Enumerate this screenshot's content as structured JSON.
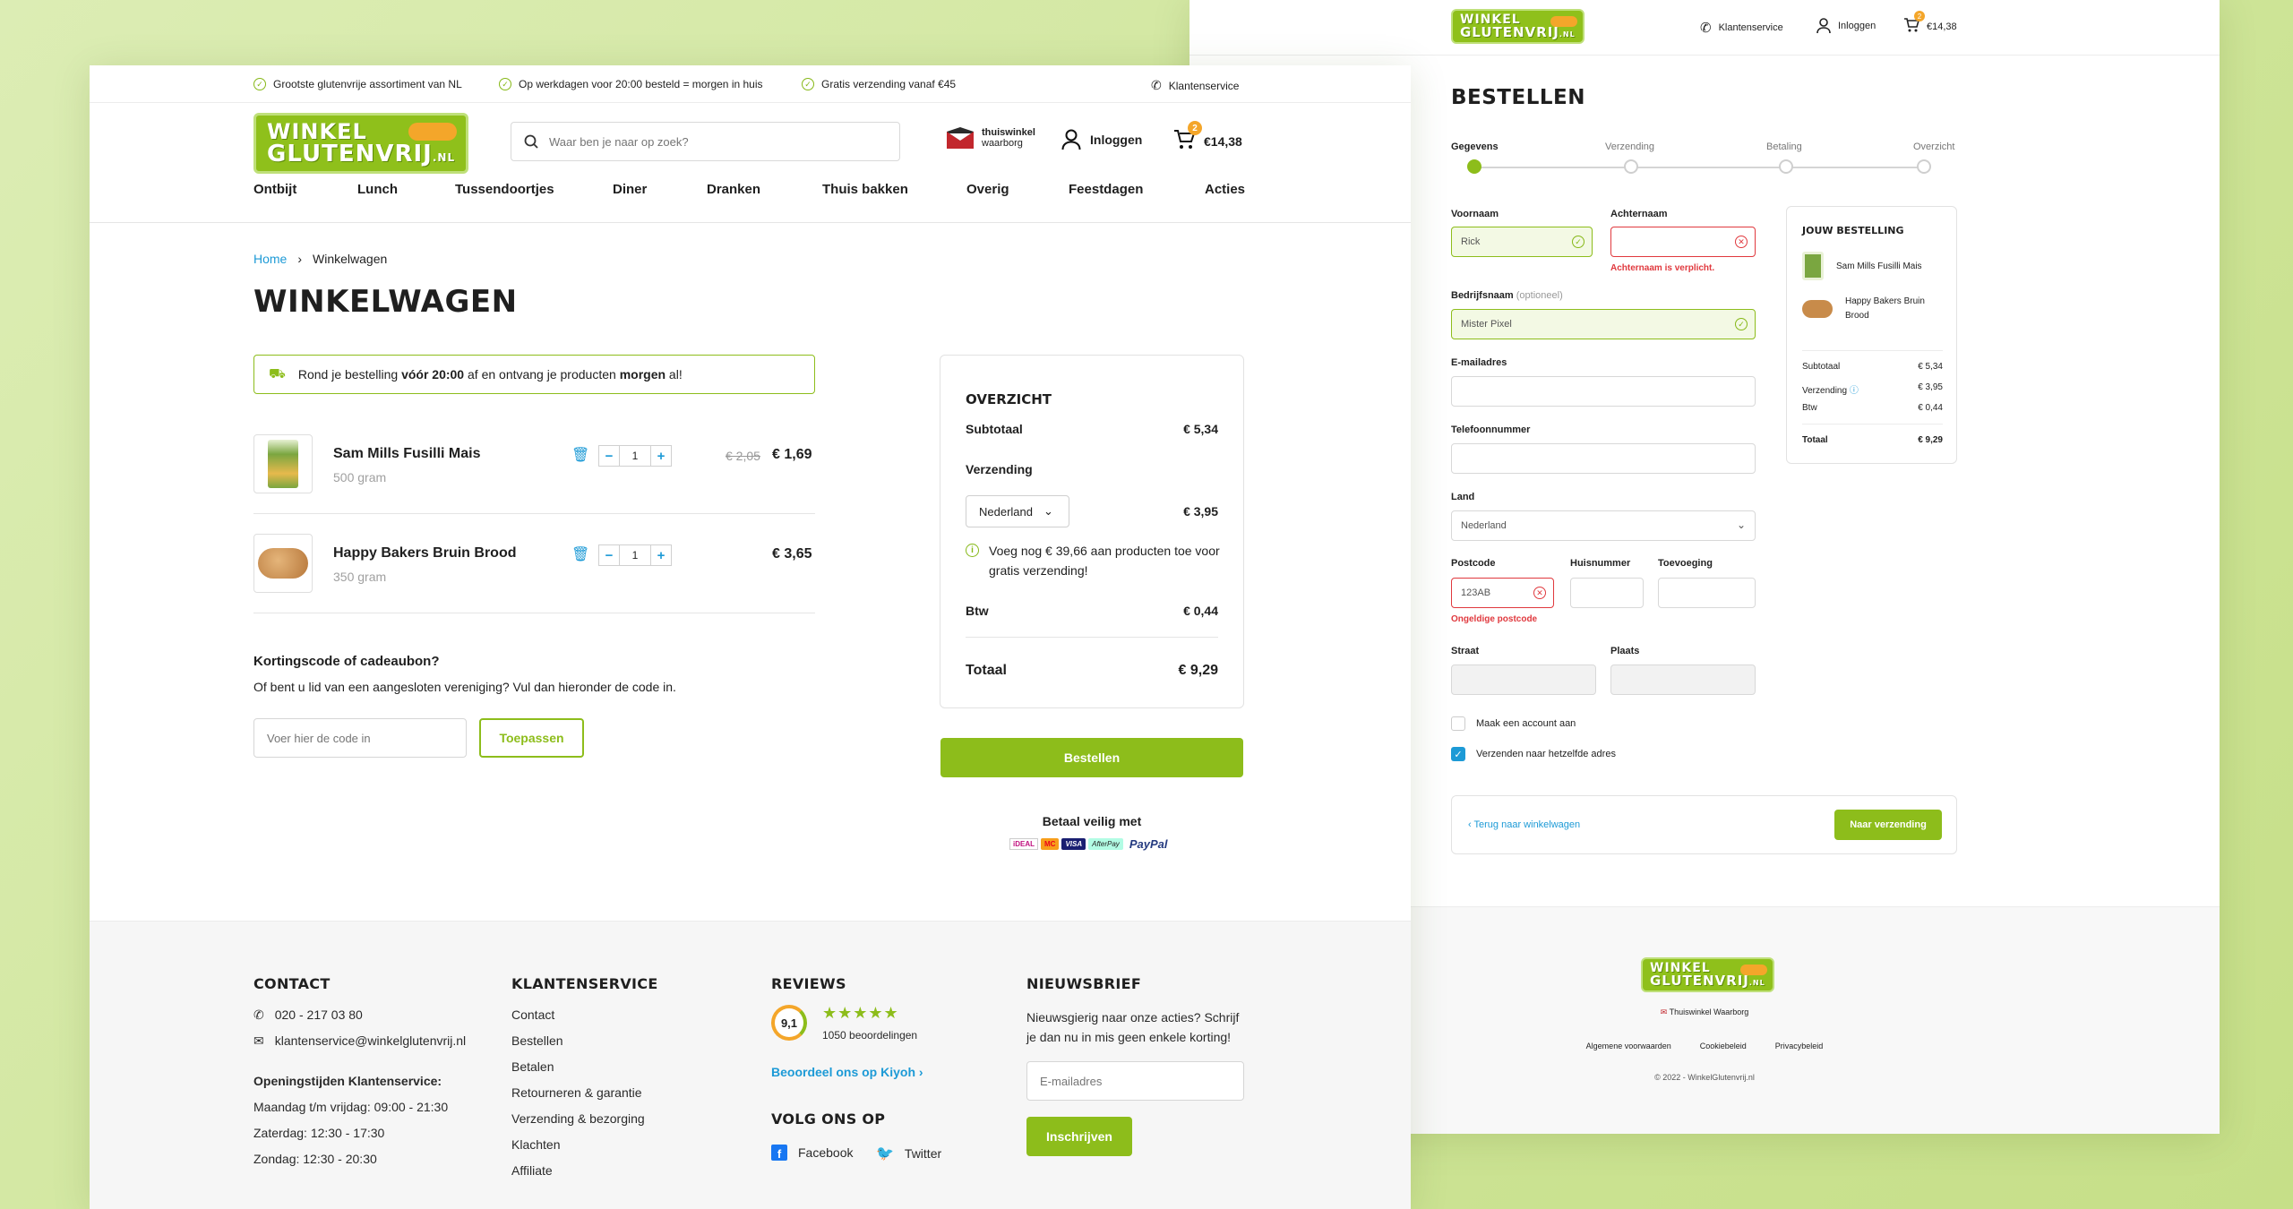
{
  "cart_page": {
    "usps": [
      "Grootste glutenvrije assortiment van NL",
      "Op werkdagen voor 20:00 besteld = morgen in huis",
      "Gratis verzending vanaf €45"
    ],
    "customer_service": "Klantenservice",
    "logo": {
      "line1": "WINKEL",
      "line2": "GLUTENVRIJ",
      "suffix": ".NL"
    },
    "search_placeholder": "Waar ben je naar op zoek?",
    "trust": {
      "line1": "thuiswinkel",
      "line2": "waarborg"
    },
    "login": "Inloggen",
    "cart_badge": "2",
    "cart_total": "€14,38",
    "nav": [
      "Ontbijt",
      "Lunch",
      "Tussendoortjes",
      "Diner",
      "Dranken",
      "Thuis bakken",
      "Overig",
      "Feestdagen",
      "Acties"
    ],
    "breadcrumb": {
      "home": "Home",
      "separator": "›",
      "current": "Winkelwagen"
    },
    "title": "Winkelwagen",
    "delivery_note": {
      "part1": "Rond je bestelling ",
      "bold1": "vóór 20:00",
      "part2": " af en ontvang je producten ",
      "bold2": "morgen",
      "part3": " al!"
    },
    "items": [
      {
        "name": "Sam Mills Fusilli Mais",
        "weight": "500 gram",
        "qty": "1",
        "old_price": "€ 2,05",
        "price": "€ 1,69"
      },
      {
        "name": "Happy Bakers Bruin Brood",
        "weight": "350 gram",
        "qty": "1",
        "old_price": "",
        "price": "€ 3,65"
      }
    ],
    "discount": {
      "title": "Kortingscode of cadeaubon?",
      "text": "Of bent u lid van een aangesloten vereniging? Vul dan hieronder de code in.",
      "placeholder": "Voer hier de code in",
      "button": "Toepassen"
    },
    "overview": {
      "title": "Overzicht",
      "subtotal_label": "Subtotaal",
      "subtotal": "€ 5,34",
      "shipping_label": "Verzending",
      "country": "Nederland",
      "shipping": "€ 3,95",
      "free_shipping_note": "Voeg nog € 39,66 aan producten toe voor gratis verzending!",
      "vat_label": "Btw",
      "vat": "€ 0,44",
      "total_label": "Totaal",
      "total": "€ 9,29"
    },
    "order_button": "Bestellen",
    "pay_safe": "Betaal veilig met",
    "payment_methods": [
      "iDEAL",
      "MC",
      "VISA",
      "AfterPay",
      "PayPal"
    ],
    "footer": {
      "contact": {
        "title": "Contact",
        "phone": "020 - 217 03 80",
        "email": "klantenservice@winkelglutenvrij.nl",
        "hours_title": "Openingstijden Klantenservice:",
        "hours": [
          "Maandag t/m vrijdag: 09:00 - 21:30",
          "Zaterdag: 12:30 - 17:30",
          "Zondag: 12:30 - 20:30"
        ]
      },
      "service": {
        "title": "Klantenservice",
        "links": [
          "Contact",
          "Bestellen",
          "Betalen",
          "Retourneren & garantie",
          "Verzending & bezorging",
          "Klachten",
          "Affiliate"
        ]
      },
      "reviews": {
        "title": "Reviews",
        "score": "9,1",
        "stars": "★★★★★",
        "count": "1050 beoordelingen",
        "link": "Beoordeel ons op Kiyoh",
        "follow": "Volg ons op",
        "facebook": "Facebook",
        "twitter": "Twitter"
      },
      "newsletter": {
        "title": "Nieuwsbrief",
        "text": "Nieuwsgierig naar onze acties? Schrijf je dan nu in mis geen enkele korting!",
        "placeholder": "E-mailadres",
        "button": "Inschrijven"
      }
    }
  },
  "checkout_page": {
    "customer_service": "Klantenservice",
    "login": "Inloggen",
    "cart_badge": "2",
    "cart_total": "€14,38",
    "title": "Bestellen",
    "steps": [
      "Gegevens",
      "Verzending",
      "Betaling",
      "Overzicht"
    ],
    "form": {
      "first_name_label": "Voornaam",
      "first_name": "Rick",
      "last_name_label": "Achternaam",
      "last_name_error": "Achternaam is verplicht.",
      "company_label": "Bedrijfsnaam",
      "company_optional": "(optioneel)",
      "company": "Mister Pixel",
      "email_label": "E-mailadres",
      "phone_label": "Telefoonnummer",
      "country_label": "Land",
      "country": "Nederland",
      "postcode_label": "Postcode",
      "postcode": "123AB",
      "postcode_error": "Ongeldige postcode",
      "house_label": "Huisnummer",
      "addition_label": "Toevoeging",
      "street_label": "Straat",
      "city_label": "Plaats",
      "create_account": "Maak een account aan",
      "same_address": "Verzenden naar hetzelfde adres"
    },
    "back_link": "Terug naar winkelwagen",
    "next_button": "Naar verzending",
    "summary": {
      "title": "Jouw bestelling",
      "items": [
        "Sam Mills Fusilli Mais",
        "Happy Bakers Bruin Brood"
      ],
      "subtotal_label": "Subtotaal",
      "subtotal": "€ 5,34",
      "shipping_label": "Verzending",
      "shipping": "€ 3,95",
      "vat_label": "Btw",
      "vat": "€ 0,44",
      "total_label": "Totaal",
      "total": "€ 9,29"
    },
    "footer": {
      "trust": "Thuiswinkel Waarborg",
      "links": [
        "Algemene voorwaarden",
        "Cookiebeleid",
        "Privacybeleid"
      ],
      "copyright": "© 2022 - WinkelGlutenvrij.nl"
    }
  },
  "colors": {
    "brand_green": "#8dbd1b",
    "link_blue": "#1d9ad6",
    "error_red": "#e0393e",
    "badge_orange": "#f4a62a"
  }
}
